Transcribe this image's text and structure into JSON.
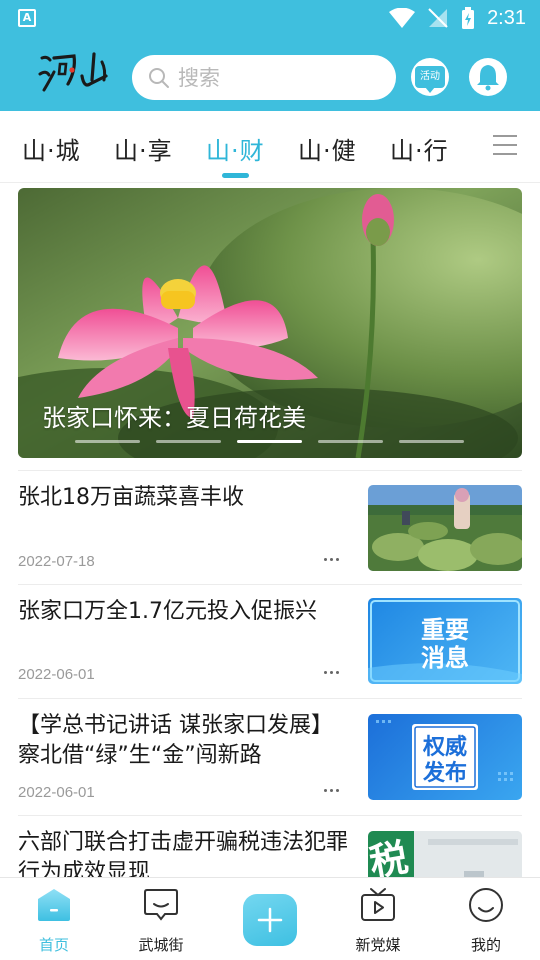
{
  "status_bar": {
    "time": "2:31",
    "app_icon_letter": "A"
  },
  "header": {
    "search_placeholder": "搜索",
    "activity_label": "活动",
    "brand_color": "#3fbfde"
  },
  "tabs": [
    {
      "label": "山·城",
      "active": false
    },
    {
      "label": "山·享",
      "active": false
    },
    {
      "label": "山·财",
      "active": true
    },
    {
      "label": "山·健",
      "active": false
    },
    {
      "label": "山·行",
      "active": false
    }
  ],
  "banner": {
    "caption": "张家口怀来：夏日荷花美",
    "slide_count": 5,
    "active_slide": 3
  },
  "news": [
    {
      "title": "张北18万亩蔬菜喜丰收",
      "date": "2022-07-18",
      "thumb": "farm-photo"
    },
    {
      "title": "张家口万全1.7亿元投入促振兴",
      "date": "2022-06-01",
      "thumb": "important-news",
      "thumb_text": "重要消息"
    },
    {
      "title": "【学总书记讲话  谋张家口发展】察北借“绿”生“金”闯新路",
      "date": "2022-06-01",
      "thumb": "authoritative-release",
      "thumb_text": "权威发布"
    },
    {
      "title": "六部门联合打击虚开骗税违法犯罪行为成效显现",
      "date": "",
      "thumb": "tax-photo",
      "thumb_text": "税"
    }
  ],
  "bottom_nav": [
    {
      "label": "首页",
      "icon": "home-icon",
      "active": true
    },
    {
      "label": "武城街",
      "icon": "chat-icon",
      "active": false
    },
    {
      "label": "",
      "icon": "plus-icon",
      "active": false
    },
    {
      "label": "新党媒",
      "icon": "tv-icon",
      "active": false
    },
    {
      "label": "我的",
      "icon": "smile-icon",
      "active": false
    }
  ]
}
